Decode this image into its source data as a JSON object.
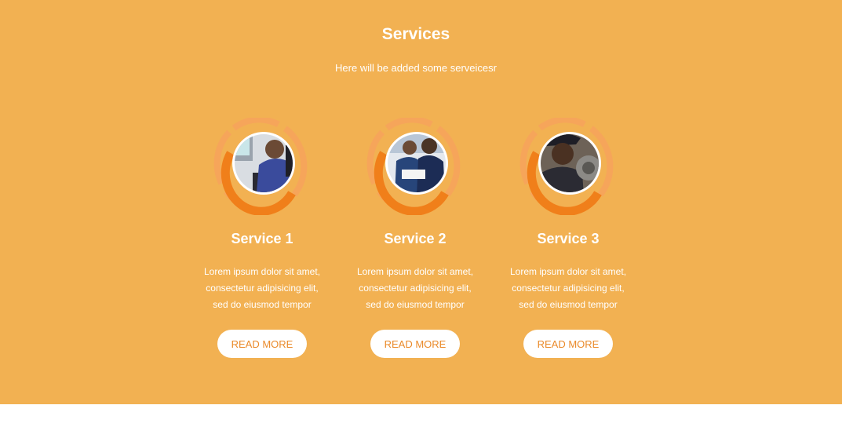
{
  "section": {
    "title": "Services",
    "subtitle": "Here will be added some serveicesr"
  },
  "services": [
    {
      "title": "Service 1",
      "lines": [
        "Lorem ipsum dolor sit amet,",
        "consectetur adipisicing elit,",
        "sed do eiusmod tempor"
      ],
      "button": "READ MORE",
      "image_icon": "worker-at-computer-photo"
    },
    {
      "title": "Service 2",
      "lines": [
        "Lorem ipsum dolor sit amet,",
        "consectetur adipisicing elit,",
        "sed do eiusmod tempor"
      ],
      "button": "READ MORE",
      "image_icon": "workers-reviewing-documents-photo"
    },
    {
      "title": "Service 3",
      "lines": [
        "Lorem ipsum dolor sit amet,",
        "consectetur adipisicing elit,",
        "sed do eiusmod tempor"
      ],
      "button": "READ MORE",
      "image_icon": "mechanic-with-engine-part-photo"
    }
  ],
  "colors": {
    "section_bg": "#f2b152",
    "ring_orange": "#f07f1a",
    "ring_light": "#f6a55a",
    "button_text": "#ea8a2a",
    "text": "#ffffff"
  }
}
